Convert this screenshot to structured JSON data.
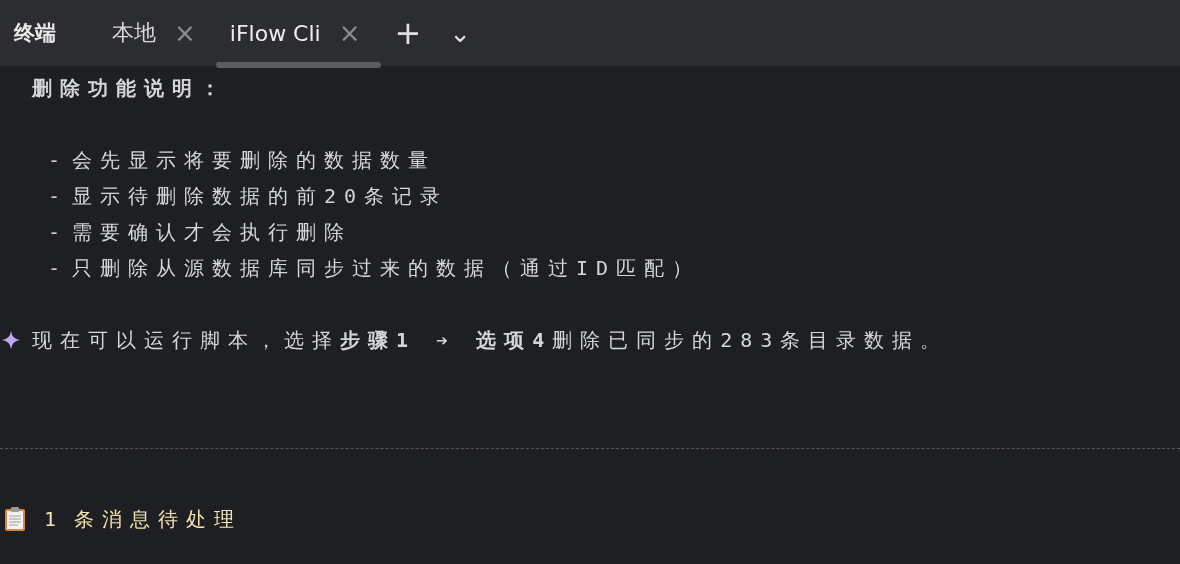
{
  "header": {
    "title": "终端",
    "tabs": [
      {
        "label": "本地",
        "selected": false,
        "close": "×"
      },
      {
        "label": "iFlow Cli",
        "selected": true,
        "close": "×"
      }
    ],
    "add": "+",
    "dropdown": "⌄"
  },
  "output": {
    "heading": "删除功能说明：",
    "bullets": [
      "会先显示将要删除的数据数量",
      "显示待删除数据的前20条记录",
      "需要确认才会执行删除",
      "只删除从源数据库同步过来的数据（通过ID匹配）"
    ],
    "bullet_mark": "-",
    "summary": "现在可以运行脚本，选择**步骤1 ➔ 选项4**删除已同步的283条目录数据。"
  },
  "status": {
    "count": "1",
    "text": "条消息待处理"
  }
}
